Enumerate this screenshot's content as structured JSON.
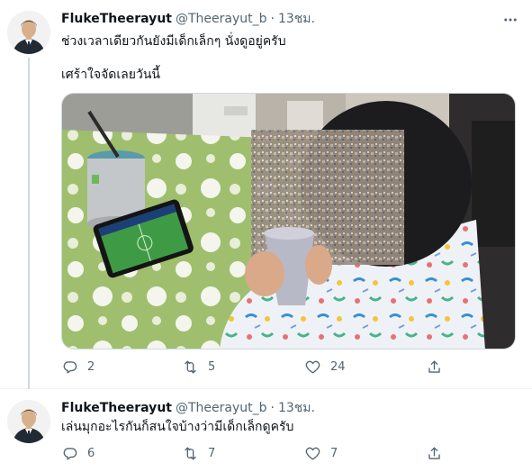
{
  "tweets": [
    {
      "name": "FlukeTheerayut",
      "handle": "@Theerayut_b",
      "separator": "·",
      "time": "13ชม.",
      "lines": [
        "ช่วงเวลาเดียวกันยังมีเด็กเล็กๆ นั่งดูอยู่ครับ",
        "เศร้าใจจัดเลยวันนี้"
      ],
      "stats": {
        "replies": "2",
        "retweets": "5",
        "likes": "24"
      }
    },
    {
      "name": "FlukeTheerayut",
      "handle": "@Theerayut_b",
      "separator": "·",
      "time": "13ชม.",
      "lines": [
        "เล่นมุกอะไรกันก็สนใจบ้างว่ามีเด็กเล็กดูครับ"
      ],
      "stats": {
        "replies": "6",
        "retweets": "7",
        "likes": "7"
      }
    }
  ],
  "icons": {
    "more": "more-horizontal-icon",
    "reply": "reply-icon",
    "retweet": "retweet-icon",
    "like": "like-icon",
    "share": "share-icon"
  },
  "colors": {
    "secondary_text": "#536471",
    "primary_text": "#0f1419",
    "thread_line": "#cfd9de"
  }
}
